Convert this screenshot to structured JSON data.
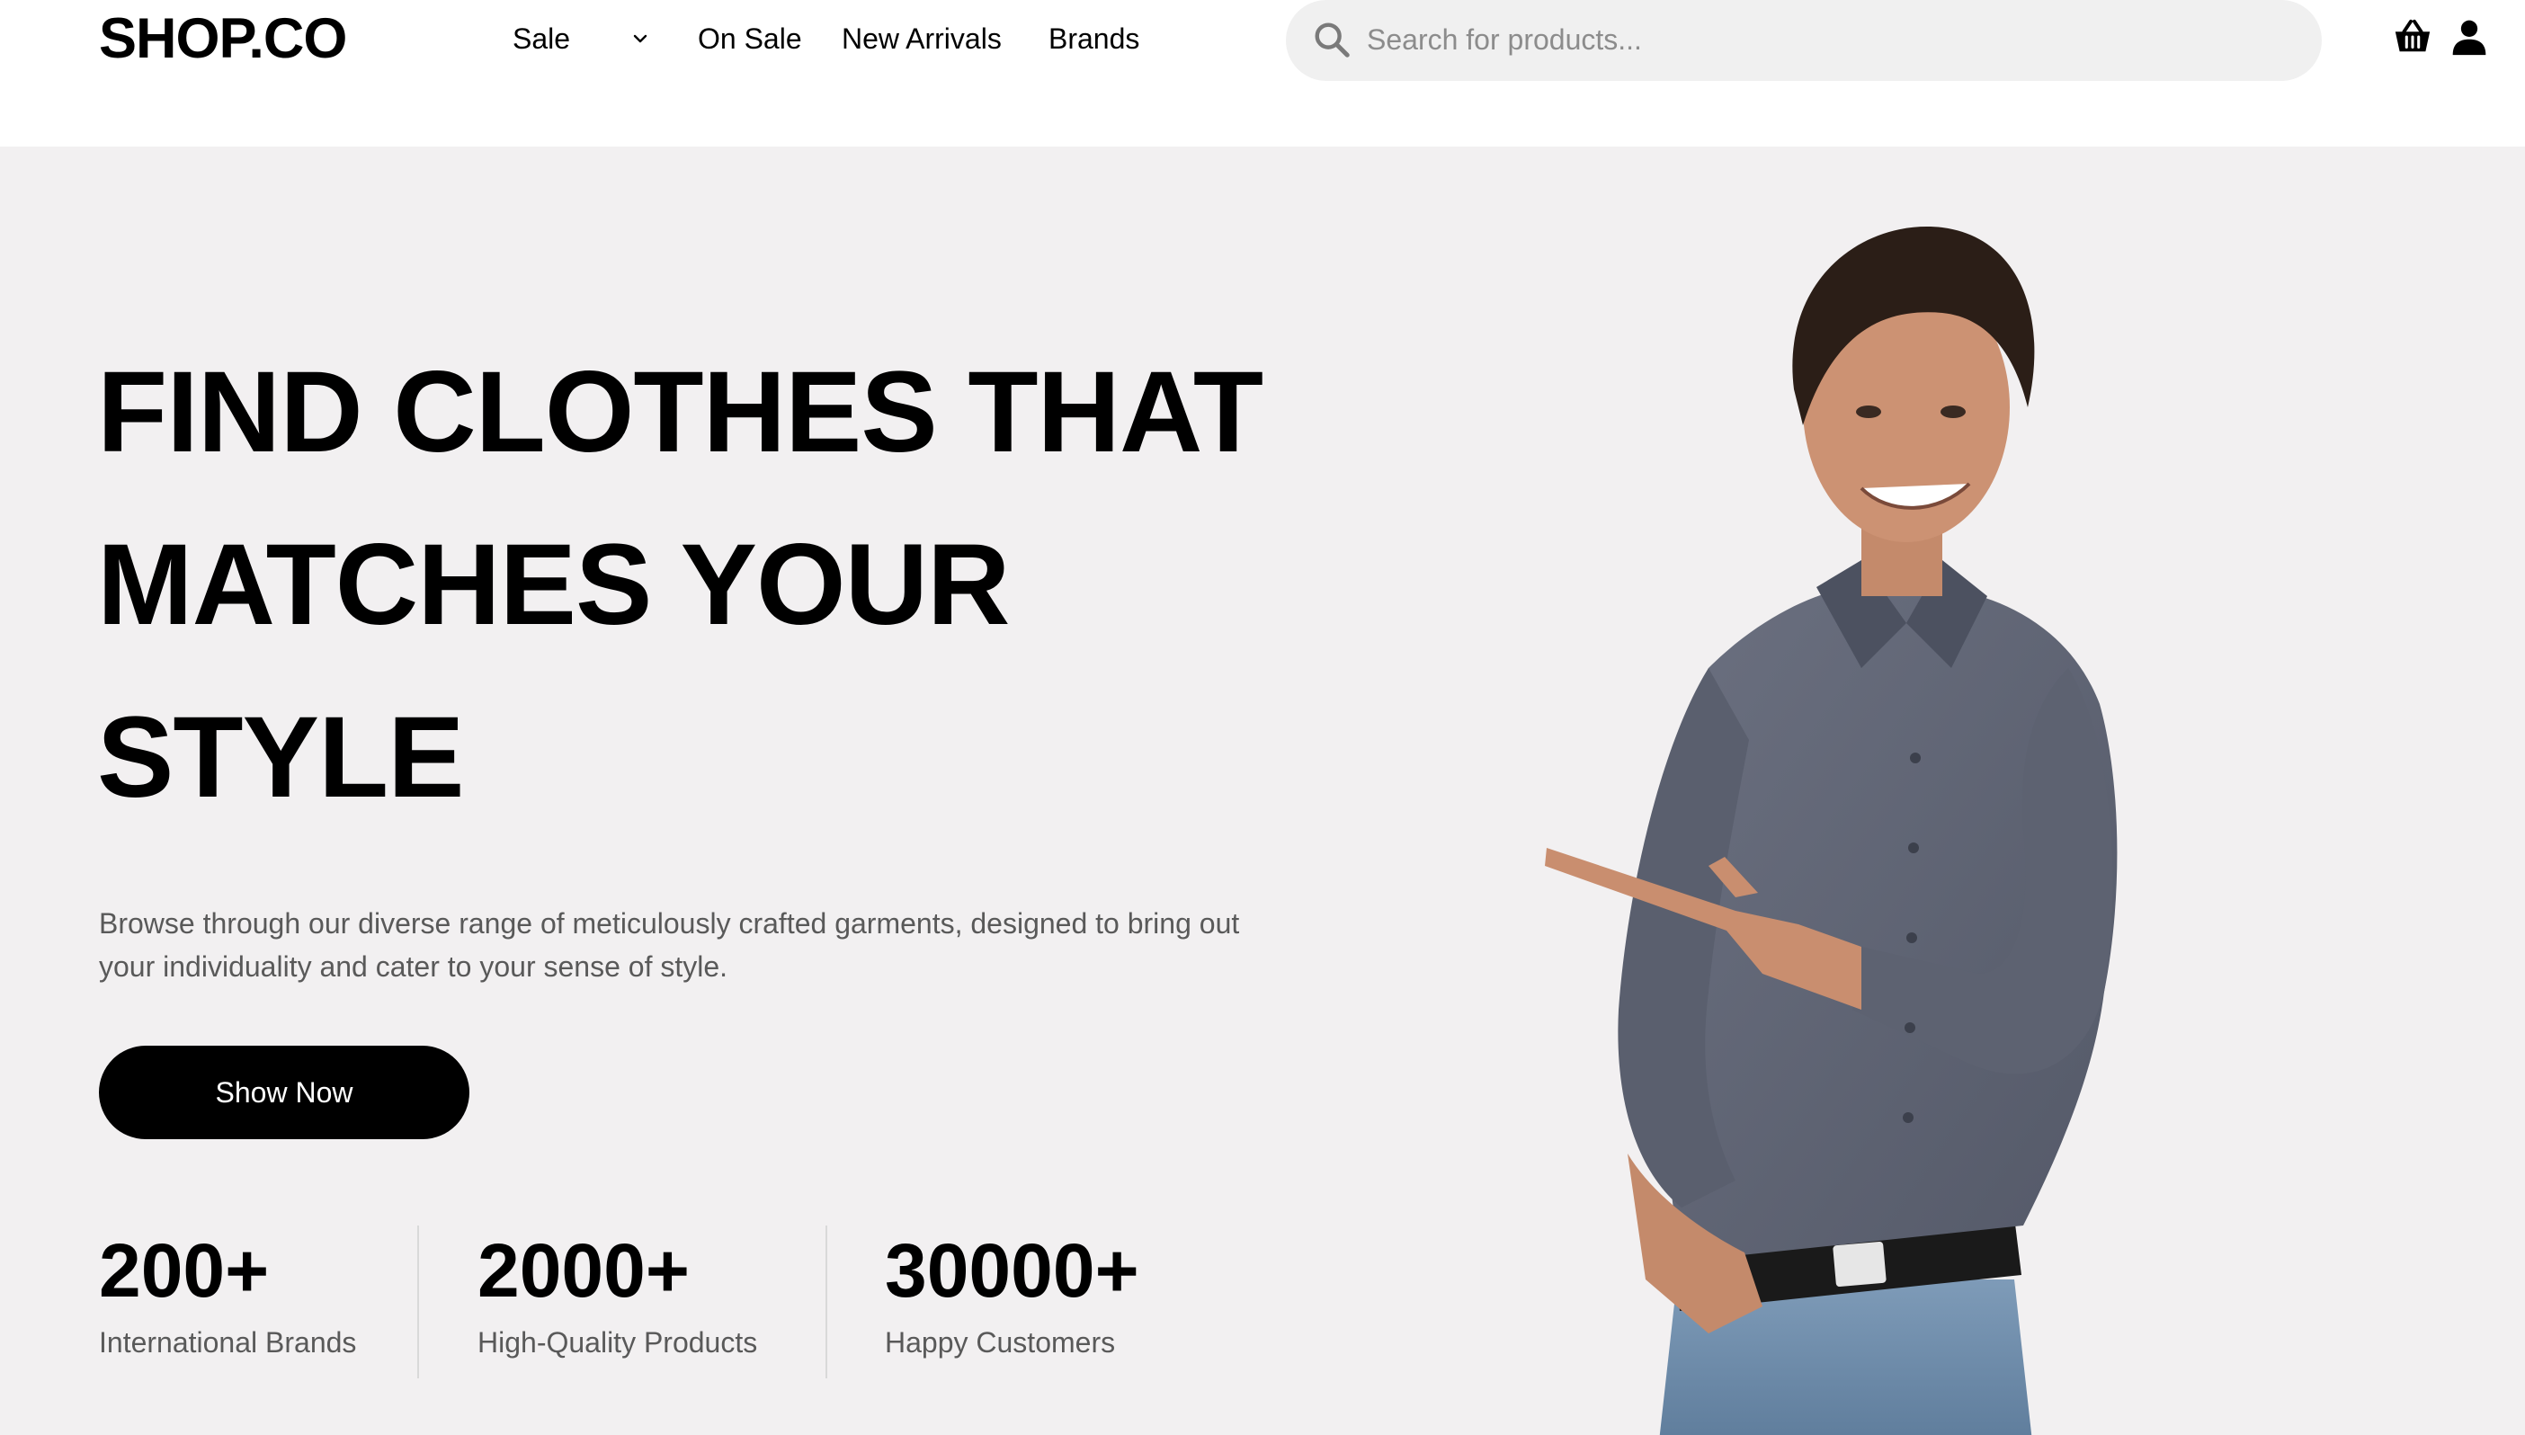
{
  "header": {
    "logo": "SHOP.CO",
    "nav": {
      "sale": "Sale",
      "on_sale": "On Sale",
      "new_arrivals": "New Arrivals",
      "brands": "Brands"
    },
    "search": {
      "placeholder": "Search for products...",
      "value": ""
    },
    "icons": [
      "search-icon",
      "cart-icon",
      "user-icon",
      "chevron-down-icon"
    ]
  },
  "hero": {
    "title": "FIND CLOTHES THAT MATCHES YOUR STYLE",
    "description": "Browse through our diverse range of meticulously crafted garments, designed to bring out your individuality and cater to your sense of style.",
    "cta_label": "Show Now",
    "stats": [
      {
        "value": "200+",
        "label": "International Brands"
      },
      {
        "value": "2000+",
        "label": "High-Quality Products"
      },
      {
        "value": "30000+",
        "label": "Happy Customers"
      }
    ]
  },
  "colors": {
    "hero_background": "#f2f0f1",
    "button_background": "#000000",
    "search_background": "#f0f0f0",
    "muted_text": "#595959"
  }
}
